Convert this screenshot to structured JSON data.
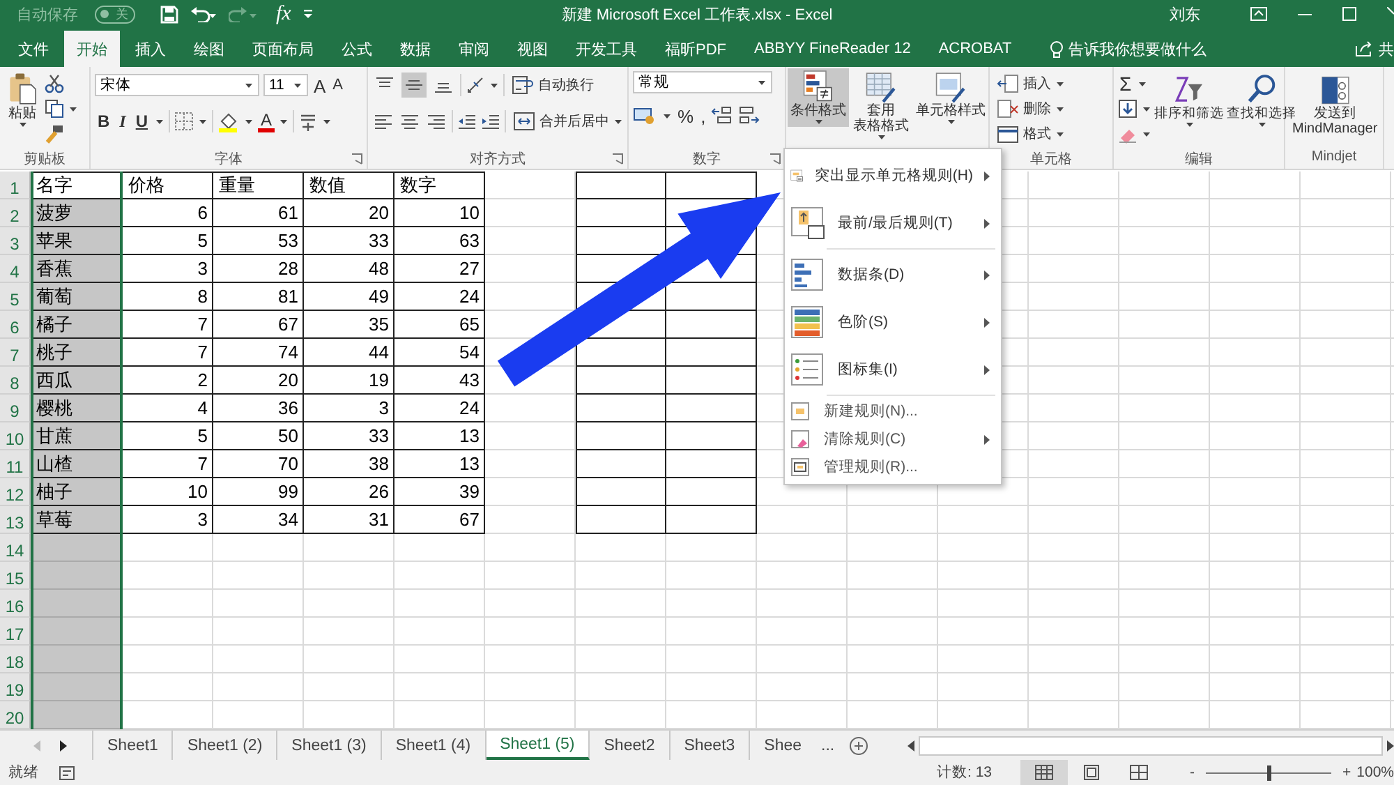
{
  "quick_access": {
    "autosave_label": "自动保存",
    "autosave_state": "关",
    "autosave_on": false,
    "formula_label": "fx"
  },
  "window": {
    "title": "新建 Microsoft Excel 工作表.xlsx  -  Excel",
    "user": "刘东"
  },
  "ribbon_tabs": [
    {
      "label": "文件",
      "selected": false
    },
    {
      "label": "开始",
      "selected": true
    },
    {
      "label": "插入",
      "selected": false
    },
    {
      "label": "绘图",
      "selected": false
    },
    {
      "label": "页面布局",
      "selected": false
    },
    {
      "label": "公式",
      "selected": false
    },
    {
      "label": "数据",
      "selected": false
    },
    {
      "label": "审阅",
      "selected": false
    },
    {
      "label": "视图",
      "selected": false
    },
    {
      "label": "开发工具",
      "selected": false
    },
    {
      "label": "福昕PDF",
      "selected": false
    },
    {
      "label": "ABBYY FineReader 12",
      "selected": false
    },
    {
      "label": "ACROBAT",
      "selected": false
    }
  ],
  "tell_me": "告诉我你想要做什么",
  "share": "共",
  "ribbon_groups": [
    {
      "kind": "clipboard",
      "label": "剪贴板",
      "paste": "粘贴"
    },
    {
      "kind": "font",
      "label": "字体",
      "font": "宋体",
      "size": "11",
      "grow": "A",
      "shrink": "A",
      "bold": "B",
      "italic": "I",
      "underline": "U",
      "font_color": "A"
    },
    {
      "kind": "alignment",
      "label": "对齐方式",
      "vertical_align": [
        {
          "selected": false
        },
        {
          "selected": true
        },
        {
          "selected": false
        }
      ],
      "wrap": "自动换行",
      "merge": "合并后居中"
    },
    {
      "kind": "number",
      "label": "数字",
      "format": "常规",
      "percent": "%",
      "comma": ","
    },
    {
      "kind": "styles",
      "buttons": [
        {
          "lines": [
            "条件格式"
          ],
          "pressed": true
        },
        {
          "lines": [
            "套用",
            "表格格式"
          ],
          "pressed": false
        },
        {
          "lines": [
            "单元格样式"
          ],
          "pressed": false
        }
      ]
    },
    {
      "kind": "cells",
      "label": "单元格",
      "items": [
        "插入",
        "删除",
        "格式"
      ]
    },
    {
      "kind": "editing",
      "label": "编辑",
      "sum": "Σ",
      "sort": "排序和筛选",
      "find": "查找和选择"
    },
    {
      "kind": "addin",
      "label": "Mindjet",
      "lines": [
        "发送到",
        "MindManager"
      ]
    }
  ],
  "sheet": {
    "row_numbers": [
      "1",
      "2",
      "3",
      "4",
      "5",
      "6",
      "7",
      "8",
      "9",
      "10",
      "11",
      "12",
      "13",
      "14",
      "15",
      "16",
      "17",
      "18",
      "19",
      "20"
    ],
    "columns": [
      {
        "selected": true
      },
      {
        "selected": false
      },
      {
        "selected": false
      },
      {
        "selected": false
      },
      {
        "selected": false
      }
    ],
    "rows": [
      {
        "kind": "header",
        "cells": [
          "名字",
          "价格",
          "重量",
          "数值",
          "数字"
        ]
      },
      {
        "kind": "data",
        "cells": [
          "菠萝",
          "6",
          "61",
          "20",
          "10"
        ]
      },
      {
        "kind": "data",
        "cells": [
          "苹果",
          "5",
          "53",
          "33",
          "63"
        ]
      },
      {
        "kind": "data",
        "cells": [
          "香蕉",
          "3",
          "28",
          "48",
          "27"
        ]
      },
      {
        "kind": "data",
        "cells": [
          "葡萄",
          "8",
          "81",
          "49",
          "24"
        ]
      },
      {
        "kind": "data",
        "cells": [
          "橘子",
          "7",
          "67",
          "35",
          "65"
        ]
      },
      {
        "kind": "data",
        "cells": [
          "桃子",
          "7",
          "74",
          "44",
          "54"
        ]
      },
      {
        "kind": "data",
        "cells": [
          "西瓜",
          "2",
          "20",
          "19",
          "43"
        ]
      },
      {
        "kind": "data",
        "cells": [
          "樱桃",
          "4",
          "36",
          "3",
          "24"
        ]
      },
      {
        "kind": "data",
        "cells": [
          "甘蔗",
          "5",
          "50",
          "33",
          "13"
        ]
      },
      {
        "kind": "data",
        "cells": [
          "山楂",
          "7",
          "70",
          "38",
          "13"
        ]
      },
      {
        "kind": "data",
        "cells": [
          "柚子",
          "10",
          "99",
          "26",
          "39"
        ]
      },
      {
        "kind": "data",
        "cells": [
          "草莓",
          "3",
          "34",
          "31",
          "67"
        ]
      }
    ]
  },
  "conditional_format_menu": [
    {
      "kind": "highlight",
      "label": "突出显示单元格规则(H)",
      "submenu": true
    },
    {
      "kind": "topbottom",
      "label": "最前/最后规则(T)",
      "submenu": true
    },
    {
      "kind": "databar",
      "label": "数据条(D)",
      "submenu": true
    },
    {
      "kind": "colorscale",
      "label": "色阶(S)",
      "submenu": true
    },
    {
      "kind": "iconset",
      "label": "图标集(I)",
      "submenu": true
    },
    {
      "kind": "new",
      "label": "新建规则(N)...",
      "submenu": false
    },
    {
      "kind": "clear",
      "label": "清除规则(C)",
      "submenu": true
    },
    {
      "kind": "manage",
      "label": "管理规则(R)...",
      "submenu": false
    }
  ],
  "sheet_tabs": [
    {
      "label": "Sheet1",
      "selected": false
    },
    {
      "label": "Sheet1 (2)",
      "selected": false
    },
    {
      "label": "Sheet1 (3)",
      "selected": false
    },
    {
      "label": "Sheet1 (4)",
      "selected": false
    },
    {
      "label": "Sheet1 (5)",
      "selected": true
    },
    {
      "label": "Sheet2",
      "selected": false
    },
    {
      "label": "Sheet3",
      "selected": false
    },
    {
      "label": "Shee",
      "selected": false
    }
  ],
  "more_sheets": "...",
  "status_bar": {
    "status": "就绪",
    "count": "计数: 13",
    "view_modes": [
      {
        "selected": true
      },
      {
        "selected": false
      },
      {
        "selected": false
      }
    ],
    "zoom_out": "-",
    "zoom_in": "+",
    "zoom": {
      "level": 0.5
    },
    "zoom_text": "100%"
  }
}
